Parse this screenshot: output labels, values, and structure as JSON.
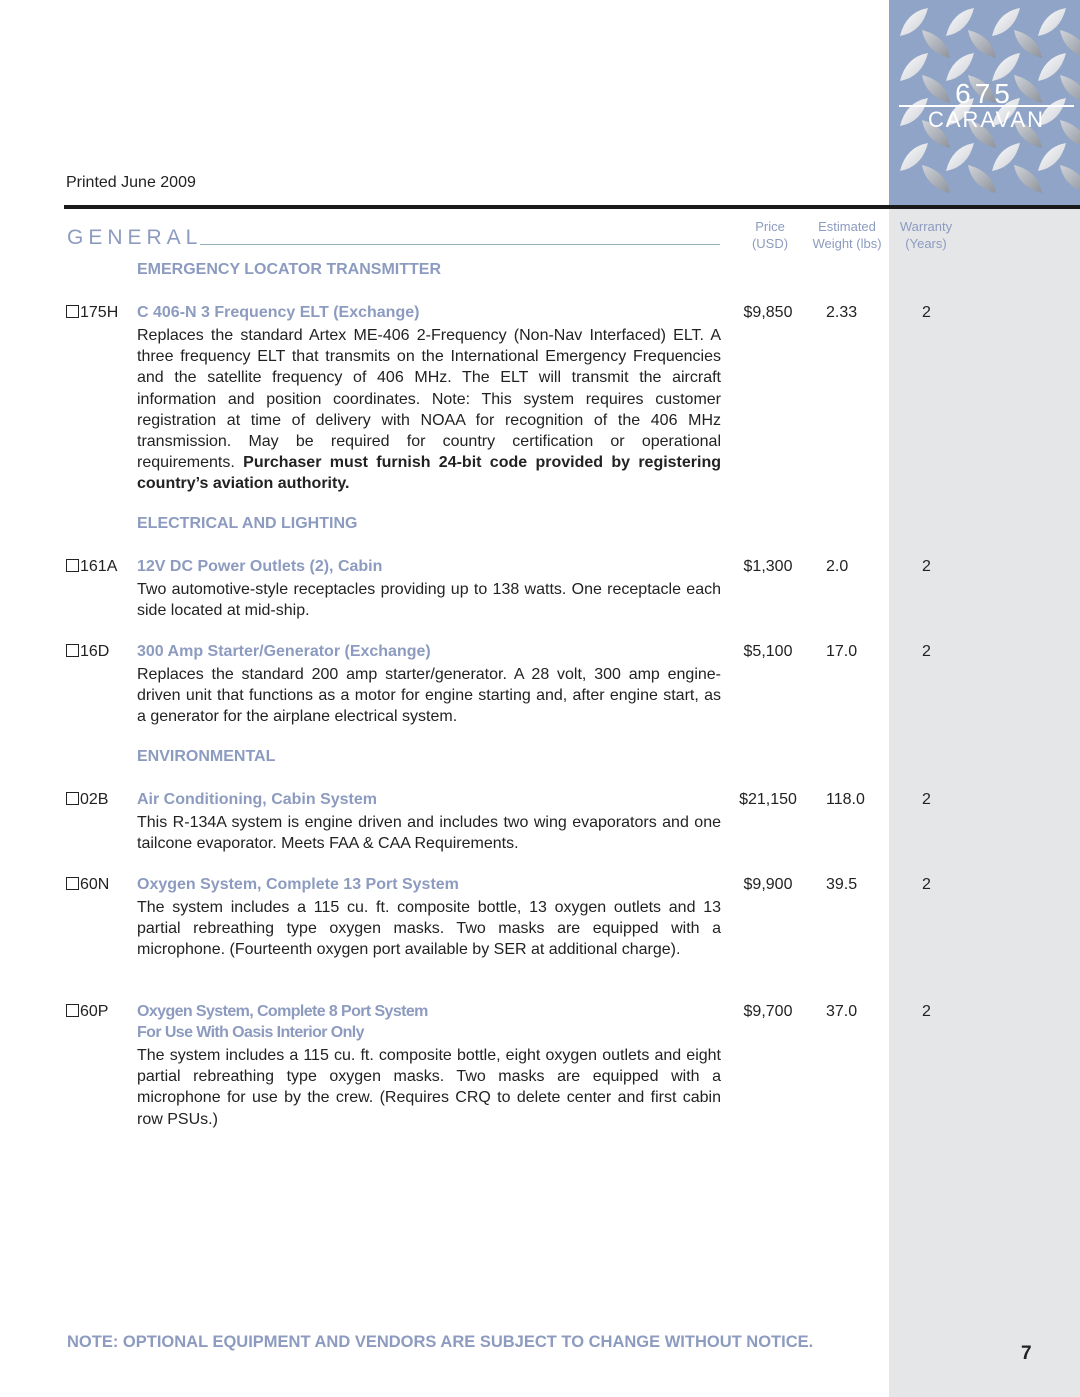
{
  "header": {
    "printed": "Printed June 2009",
    "logo": {
      "number": "675",
      "name": "CARAVAN"
    }
  },
  "section": {
    "title": "GENERAL",
    "columns": {
      "price": [
        "Price",
        "(USD)"
      ],
      "weight": [
        "Estimated",
        "Weight (lbs)"
      ],
      "warranty": [
        "Warranty",
        "(Years)"
      ]
    }
  },
  "categories": [
    "EMERGENCY LOCATOR TRANSMITTER",
    "ELECTRICAL AND LIGHTING",
    "ENVIRONMENTAL"
  ],
  "items": [
    {
      "code": "175H",
      "title": "C 406-N 3 Frequency ELT (Exchange)",
      "description": "Replaces the standard Artex ME-406 2-Frequency (Non-Nav Interfaced) ELT. A three frequency ELT that transmits on the International Emergency Frequencies and the satellite frequency of 406 MHz. The ELT will transmit the aircraft information and position coordinates. Note: This system requires customer registration at time of delivery with NOAA for recognition of the 406 MHz transmission. May be required for country certification or operational requirements.",
      "description_bold": "Purchaser must furnish 24-bit code provided by registering country’s aviation authority.",
      "price": "$9,850",
      "weight": "2.33",
      "warranty": "2"
    },
    {
      "code": "161A",
      "title": "12V DC Power Outlets (2), Cabin",
      "description": "Two automotive-style receptacles providing up to 138 watts. One receptacle each side located at mid-ship.",
      "price": "$1,300",
      "weight": "2.0",
      "warranty": "2"
    },
    {
      "code": "16D",
      "title": "300 Amp Starter/Generator (Exchange)",
      "description": "Replaces the standard 200 amp starter/generator. A 28 volt, 300 amp engine-driven unit that functions as a motor for engine starting and, after engine start, as a generator for the airplane electrical system.",
      "price": "$5,100",
      "weight": "17.0",
      "warranty": "2"
    },
    {
      "code": "02B",
      "title": "Air Conditioning, Cabin System",
      "description": "This R-134A system is engine driven and includes two wing evaporators and one tailcone evaporator. Meets FAA & CAA Requirements.",
      "price": "$21,150",
      "weight": "118.0",
      "warranty": "2"
    },
    {
      "code": "60N",
      "title": "Oxygen System, Complete 13 Port System",
      "description": "The system includes a 115 cu. ft. composite bottle, 13 oxygen outlets and 13 partial rebreathing type oxygen masks. Two masks are equipped with a microphone. (Fourteenth oxygen port available by SER at additional charge).",
      "price": "$9,900",
      "weight": "39.5",
      "warranty": "2"
    },
    {
      "code": "60P",
      "title": "Oxygen System, Complete 8 Port System",
      "subtitle": "For Use With Oasis Interior Only",
      "description": "The system includes a 115 cu. ft. composite bottle, eight oxygen outlets and eight partial rebreathing type oxygen masks. Two masks are equipped with a microphone for use by the crew. (Requires CRQ to delete center and first cabin row PSUs.)",
      "price": "$9,700",
      "weight": "37.0",
      "warranty": "2"
    }
  ],
  "footer": {
    "note": "NOTE:  OPTIONAL EQUIPMENT AND VENDORS ARE SUBJECT TO CHANGE WITHOUT NOTICE.",
    "page_number": "7"
  }
}
